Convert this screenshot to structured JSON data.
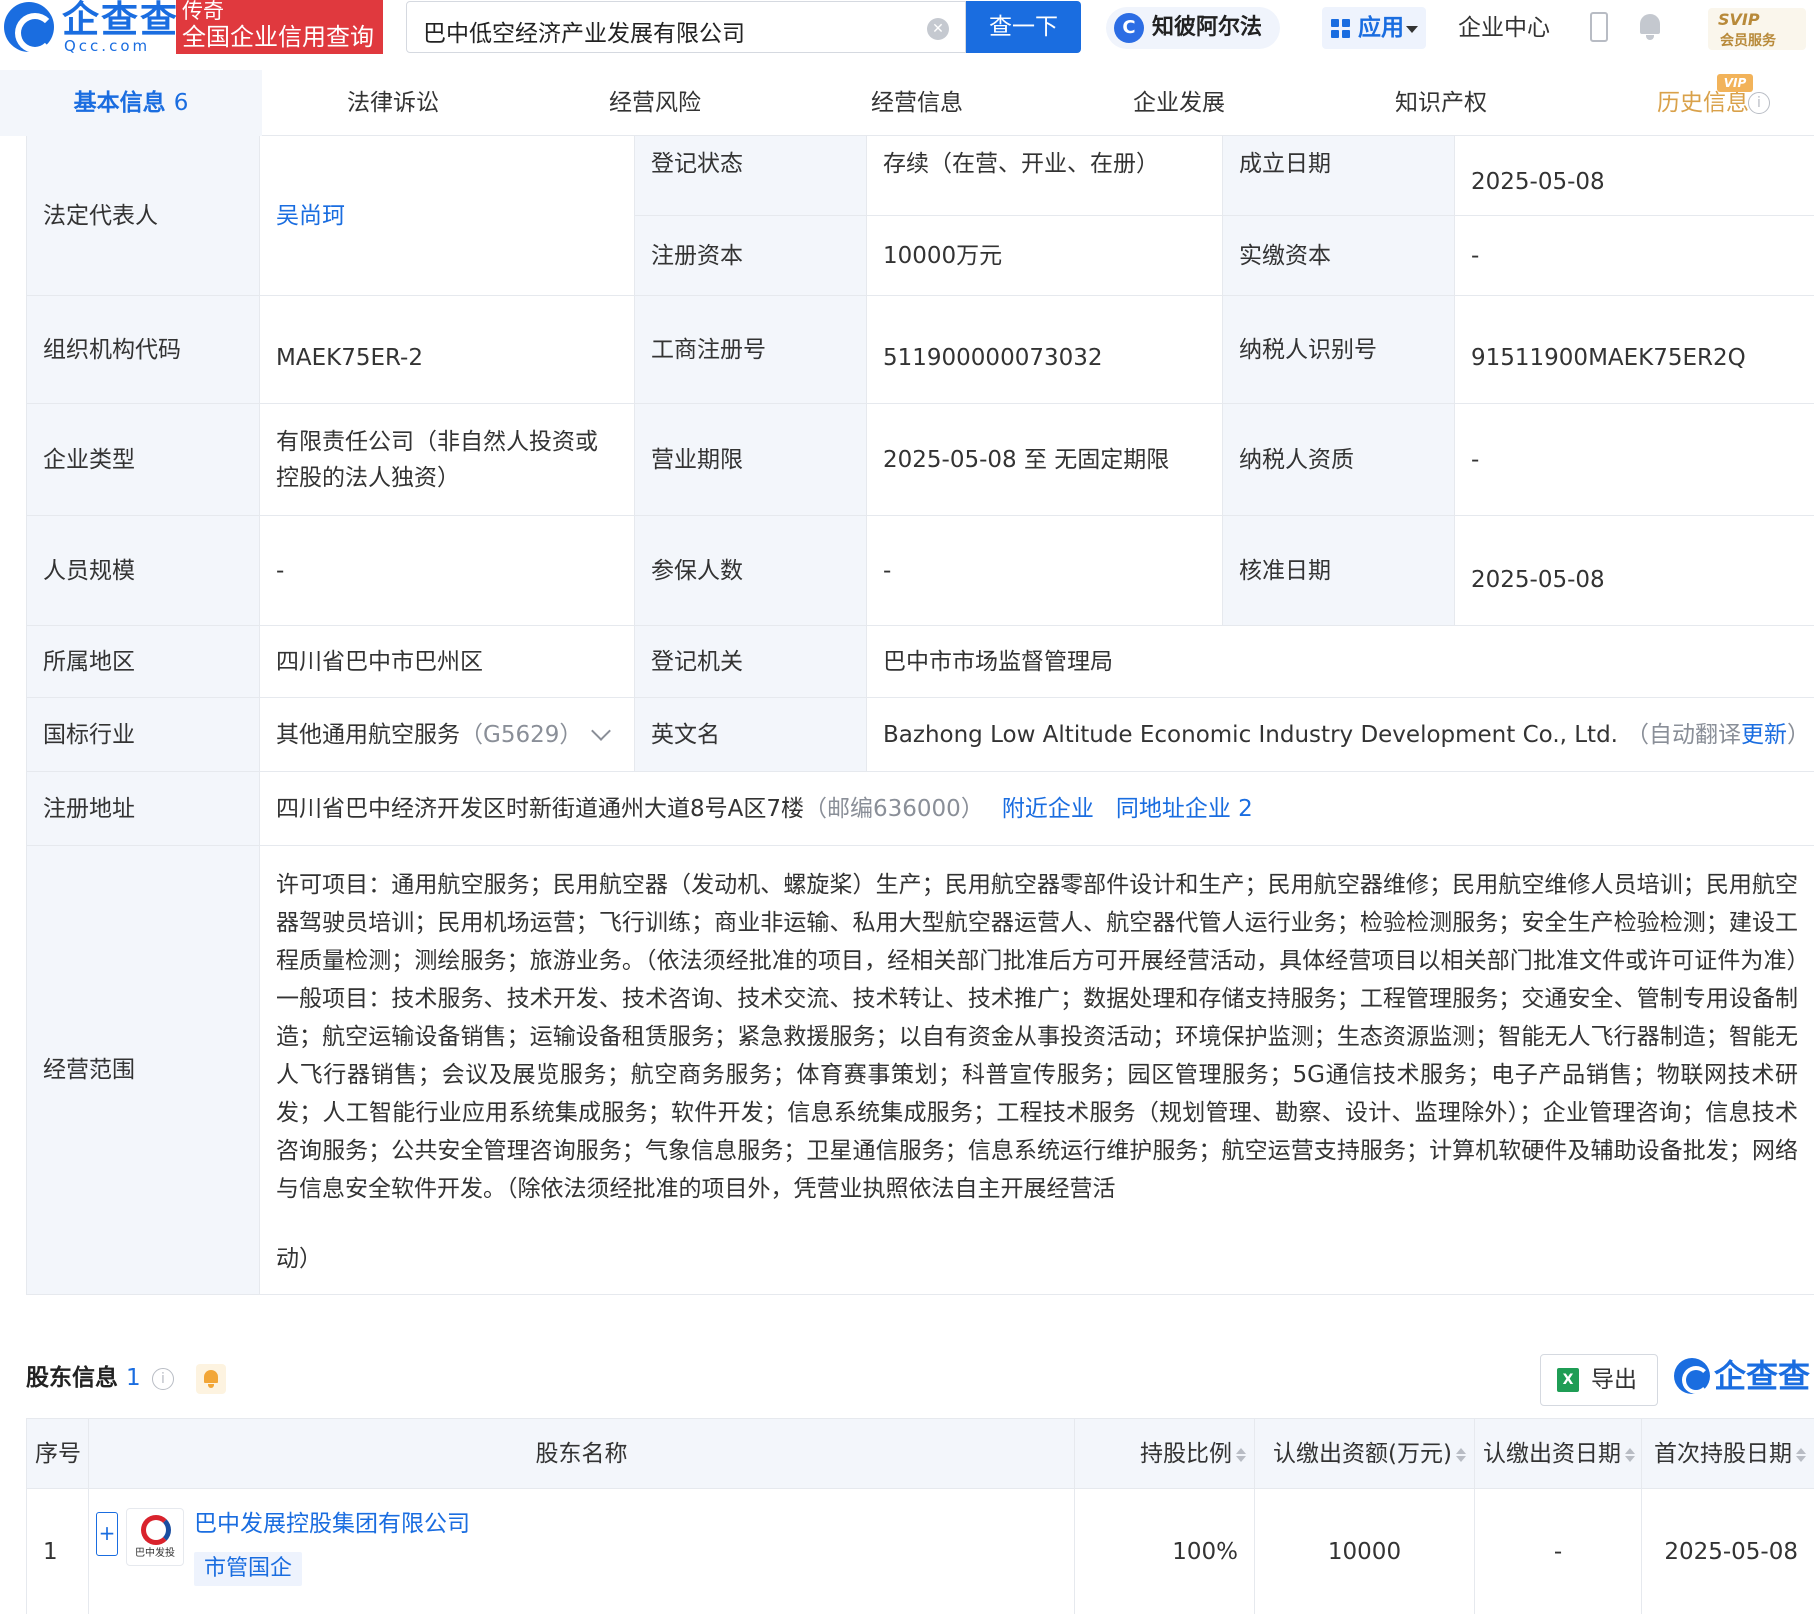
{
  "header": {
    "logo_text": "企查查",
    "logo_sub": "Qcc.com",
    "promo_line1": "传奇",
    "promo_line2": "全国企业信用查询",
    "search_value": "巴中低空经济产业发展有限公司",
    "search_button": "查一下",
    "ai_label": "知彼阿尔法",
    "apps_label": "应用",
    "center_label": "企业中心",
    "vip_top": "SVIP",
    "vip_bottom": "会员服务"
  },
  "tabs": [
    {
      "label": "基本信息",
      "count": "6"
    },
    {
      "label": "法律诉讼"
    },
    {
      "label": "经营风险"
    },
    {
      "label": "经营信息"
    },
    {
      "label": "企业发展"
    },
    {
      "label": "知识产权"
    },
    {
      "label": "历史信息"
    }
  ],
  "vip_tag": "VIP",
  "basic_info": {
    "legal_rep_label": "法定代表人",
    "legal_rep_value": "吴尚珂",
    "reg_status_label": "登记状态",
    "reg_status_value": "存续（在营、开业、在册）",
    "found_date_label": "成立日期",
    "found_date_value": "2025-05-08",
    "reg_capital_label": "注册资本",
    "reg_capital_value": "10000万元",
    "paid_capital_label": "实缴资本",
    "paid_capital_value": "-",
    "org_code_label": "组织机构代码",
    "org_code_value": "MAEK75ER-2",
    "biz_reg_no_label": "工商注册号",
    "biz_reg_no_value": "511900000073032",
    "taxpayer_id_label": "纳税人识别号",
    "taxpayer_id_value": "91511900MAEK75ER2Q",
    "company_type_label": "企业类型",
    "company_type_value": "有限责任公司（非自然人投资或控股的法人独资）",
    "term_label": "营业期限",
    "term_value": "2025-05-08 至 无固定期限",
    "taxpayer_qual_label": "纳税人资质",
    "taxpayer_qual_value": "-",
    "staff_label": "人员规模",
    "staff_value": "-",
    "insured_label": "参保人数",
    "insured_value": "-",
    "approval_label": "核准日期",
    "approval_value": "2025-05-08",
    "region_label": "所属地区",
    "region_value": "四川省巴中市巴州区",
    "authority_label": "登记机关",
    "authority_value": "巴中市市场监督管理局",
    "industry_label": "国标行业",
    "industry_value": "其他通用航空服务",
    "industry_code": "（G5629）",
    "english_label": "英文名",
    "english_value": "Bazhong Low Altitude Economic Industry Development Co., Ltd.",
    "english_note_prefix": "（自动翻译",
    "english_note_link": "更新",
    "english_note_suffix": "）",
    "address_label": "注册地址",
    "address_value": "四川省巴中经济开发区时新街道通州大道8号A区7楼",
    "address_postcode": "（邮编636000）",
    "nearby_link": "附近企业",
    "same_address_link": "同地址企业 2",
    "scope_label": "经营范围",
    "scope_value": "许可项目：通用航空服务；民用航空器（发动机、螺旋桨）生产；民用航空器零部件设计和生产；民用航空器维修；民用航空维修人员培训；民用航空器驾驶员培训；民用机场运营；飞行训练；商业非运输、私用大型航空器运营人、航空器代管人运行业务；检验检测服务；安全生产检验检测；建设工程质量检测；测绘服务；旅游业务。（依法须经批准的项目，经相关部门批准后方可开展经营活动，具体经营项目以相关部门批准文件或许可证件为准）一般项目：技术服务、技术开发、技术咨询、技术交流、技术转让、技术推广；数据处理和存储支持服务；工程管理服务；交通安全、管制专用设备制造；航空运输设备销售；运输设备租赁服务；紧急救援服务；以自有资金从事投资活动；环境保护监测；生态资源监测；智能无人飞行器制造；智能无人飞行器销售；会议及展览服务；航空商务服务；体育赛事策划；科普宣传服务；园区管理服务；5G通信技术服务；电子产品销售；物联网技术研发；人工智能行业应用系统集成服务；软件开发；信息系统集成服务；工程技术服务（规划管理、勘察、设计、监理除外）；企业管理咨询；信息技术咨询服务；公共安全管理咨询服务；气象信息服务；卫星通信服务；信息系统运行维护服务；航空运营支持服务；计算机软硬件及辅助设备批发；网络与信息安全软件开发。（除依法须经批准的项目外，凭营业执照依法自主开展经营活",
    "scope_tail": "动）"
  },
  "shareholders": {
    "title": "股东信息",
    "count": "1",
    "export_label": "导出",
    "brand_text": "企查查",
    "columns": [
      "序号",
      "股东名称",
      "持股比例",
      "认缴出资额(万元)",
      "认缴出资日期",
      "首次持股日期"
    ],
    "rows": [
      {
        "index": "1",
        "name": "巴中发展控股集团有限公司",
        "tag": "市管国企",
        "logo_text": "巴中发投",
        "ratio": "100%",
        "amount": "10000",
        "sub_date": "-",
        "first_date": "2025-05-08"
      }
    ]
  }
}
